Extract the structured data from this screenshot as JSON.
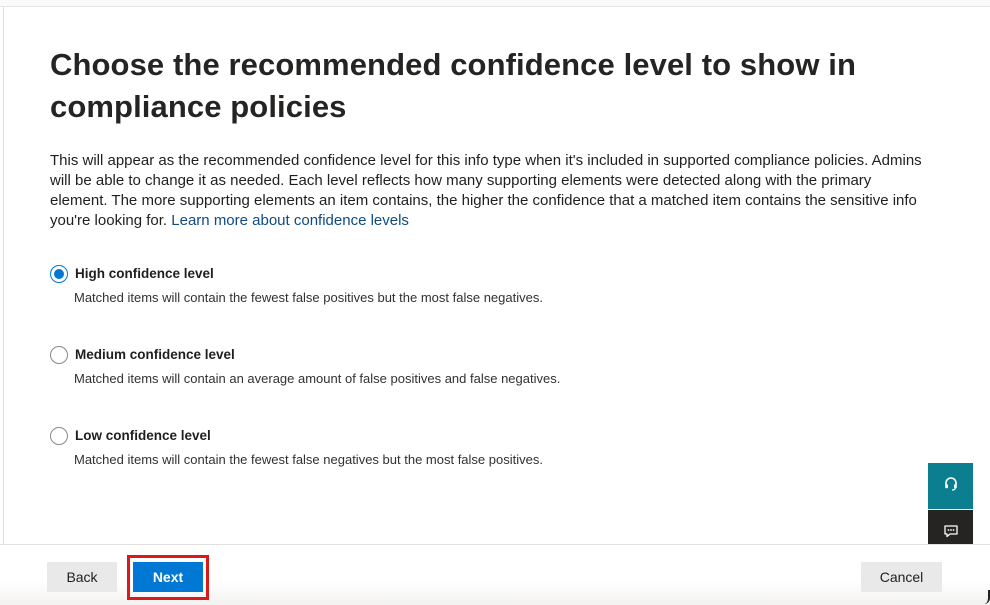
{
  "page": {
    "title": "Choose the recommended confidence level to show in compliance policies",
    "description": "This will appear as the recommended confidence level for this info type when it's included in supported compliance policies. Admins will be able to change it as needed. Each level reflects how many supporting elements were detected along with the primary element. The more supporting elements an item contains, the higher the confidence that a matched item contains the sensitive info you're looking for.",
    "learn_more_link": "Learn more about confidence levels"
  },
  "options": [
    {
      "label": "High confidence level",
      "description": "Matched items will contain the fewest false positives but the most false negatives.",
      "selected": true
    },
    {
      "label": "Medium confidence level",
      "description": "Matched items will contain an average amount of false positives and false negatives.",
      "selected": false
    },
    {
      "label": "Low confidence level",
      "description": "Matched items will contain the fewest false negatives but the most false positives.",
      "selected": false
    }
  ],
  "footer": {
    "back_label": "Back",
    "next_label": "Next",
    "cancel_label": "Cancel"
  },
  "side_panel": {
    "help_icon": "headset-icon",
    "feedback_icon": "feedback-icon"
  },
  "colors": {
    "primary": "#0078d4",
    "link": "#0f4a85",
    "highlight": "#d91a1a",
    "help_button": "#0b7f8f",
    "feedback_button": "#252423"
  }
}
